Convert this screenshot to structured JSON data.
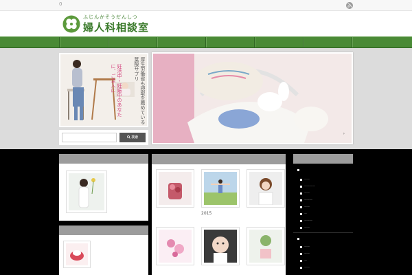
{
  "topbar": {
    "count": "0",
    "rss_icon": "rss-icon"
  },
  "header": {
    "logo_icon": "clover-logo-icon",
    "logo_subtitle": "ふじんかそうだんしつ",
    "logo_title": "婦人科相談室"
  },
  "nav": {
    "item_count": 8
  },
  "promo": {
    "vertical_text": "厚生労働省も摂取を薦めている葉酸サプリ",
    "vertical_text_pink": "妊活中・妊娠中のあなたに、ご主人に"
  },
  "search": {
    "placeholder": "",
    "button_label": "検索"
  },
  "slideshow": {
    "arrow": "›"
  },
  "mid_grid": {
    "items": [
      {
        "caption": ""
      },
      {
        "caption": "2015"
      },
      {
        "caption": ""
      },
      {
        "caption": ""
      },
      {
        "caption": ""
      },
      {
        "caption": ""
      }
    ]
  },
  "colors": {
    "nav_green": "#4a8a36",
    "logo_green": "#3a7a2a",
    "panel_head_gray": "#9c9c9c",
    "feature_bg": "#dcdcdc"
  }
}
